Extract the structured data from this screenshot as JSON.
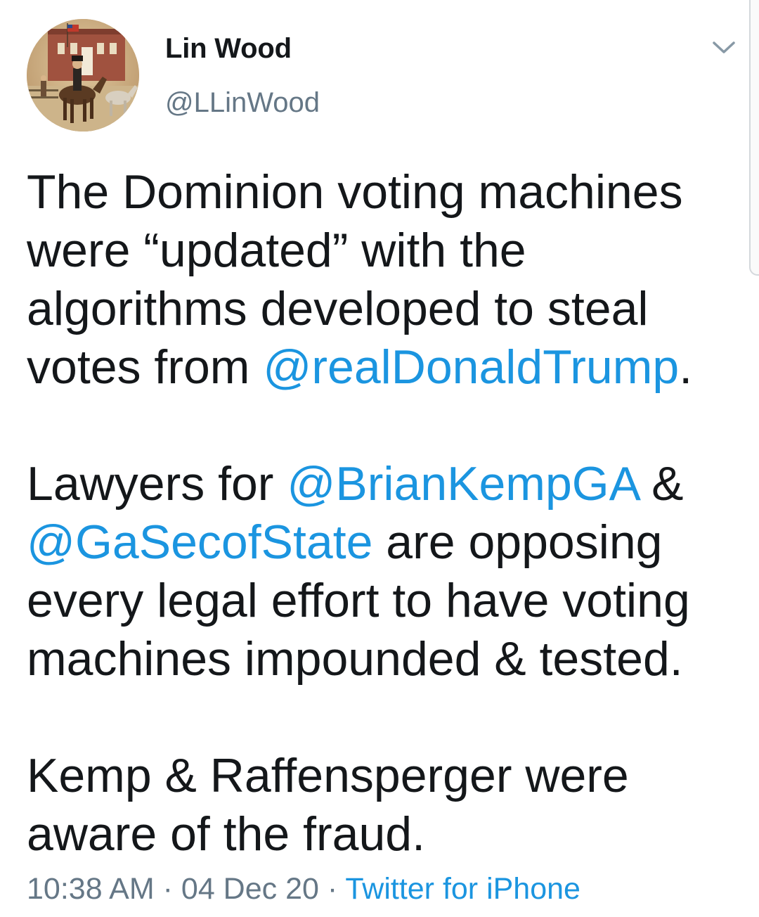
{
  "author": {
    "name": "Lin Wood",
    "handle": "@LLinWood",
    "avatar": "avatar-painting-horse-rider"
  },
  "menu_icon": "chevron-down-icon",
  "tweet": {
    "p1_a": "The Dominion voting machines were “updated” with the algorithms developed to steal votes from ",
    "p1_mention": "@realDonaldTrump",
    "p1_b": ".",
    "p2_a": "Lawyers for ",
    "p2_mention1": "@BrianKempGA",
    "p2_b": " & ",
    "p2_mention2": "@GaSecofState",
    "p2_c": " are opposing every legal effort to have voting machines impounded & tested.",
    "p3": "Kemp & Raffensperger were aware of the fraud."
  },
  "meta": {
    "time": "10:38 AM",
    "sep1": " · ",
    "date": "04 Dec 20",
    "sep2": " · ",
    "source": "Twitter for iPhone"
  },
  "colors": {
    "link": "#1b95e0",
    "secondary_text": "#657786",
    "primary_text": "#14171a"
  }
}
